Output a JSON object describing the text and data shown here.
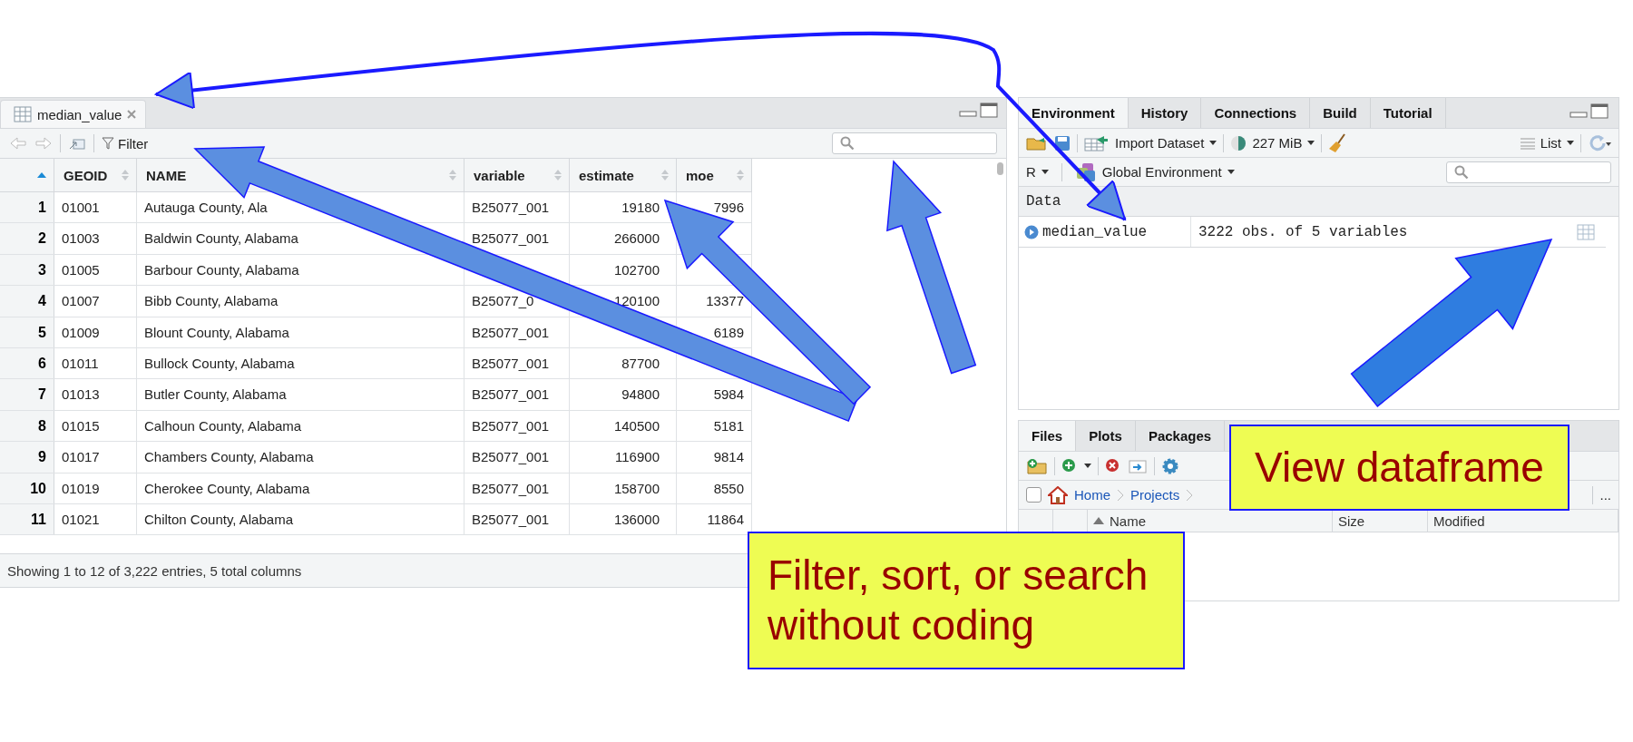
{
  "viewer_pane": {
    "tab": {
      "title": "median_value",
      "selected": true
    },
    "filter_label": "Filter",
    "columns": [
      {
        "label": "GEOID"
      },
      {
        "label": "NAME"
      },
      {
        "label": "variable"
      },
      {
        "label": "estimate"
      },
      {
        "label": "moe"
      }
    ],
    "rows": [
      {
        "index": "1",
        "cells": [
          "01001",
          "Autauga County, Ala",
          "B25077_001",
          "19180",
          "7996"
        ]
      },
      {
        "index": "2",
        "cells": [
          "01003",
          "Baldwin County, Alabama",
          "B25077_001",
          "266000",
          null
        ]
      },
      {
        "index": "3",
        "cells": [
          "01005",
          "Barbour County, Alabama",
          null,
          "102700",
          null
        ]
      },
      {
        "index": "4",
        "cells": [
          "01007",
          "Bibb County, Alabama",
          "B25077_0",
          "120100",
          "13377"
        ]
      },
      {
        "index": "5",
        "cells": [
          "01009",
          "Blount County, Alabama",
          "B25077_001",
          null,
          "6189"
        ]
      },
      {
        "index": "6",
        "cells": [
          "01011",
          "Bullock County, Alabama",
          "B25077_001",
          "87700",
          null
        ]
      },
      {
        "index": "7",
        "cells": [
          "01013",
          "Butler County, Alabama",
          "B25077_001",
          "94800",
          "5984"
        ]
      },
      {
        "index": "8",
        "cells": [
          "01015",
          "Calhoun County, Alabama",
          "B25077_001",
          "140500",
          "5181"
        ]
      },
      {
        "index": "9",
        "cells": [
          "01017",
          "Chambers County, Alabama",
          "B25077_001",
          "116900",
          "9814"
        ]
      },
      {
        "index": "10",
        "cells": [
          "01019",
          "Cherokee County, Alabama",
          "B25077_001",
          "158700",
          "8550"
        ]
      },
      {
        "index": "11",
        "cells": [
          "01021",
          "Chilton County, Alabama",
          "B25077_001",
          "136000",
          "11864"
        ]
      }
    ],
    "footer": "Showing 1 to 12 of 3,222 entries, 5 total columns"
  },
  "environment_pane": {
    "tabs": [
      {
        "label": "Environment",
        "selected": true
      },
      {
        "label": "History",
        "selected": false
      },
      {
        "label": "Connections",
        "selected": false
      },
      {
        "label": "Build",
        "selected": false
      },
      {
        "label": "Tutorial",
        "selected": false
      }
    ],
    "import_label": "Import Dataset",
    "memory": "227 MiB",
    "view_mode": "List",
    "language": "R",
    "scope": "Global Environment",
    "section": "Data",
    "objects": [
      {
        "name": "median_value",
        "summary": "3222 obs. of 5 variables"
      }
    ]
  },
  "files_pane": {
    "tabs": [
      {
        "label": "Files",
        "selected": true
      },
      {
        "label": "Plots",
        "selected": false
      },
      {
        "label": "Packages",
        "selected": false
      }
    ],
    "select_all_checked": false,
    "breadcrumbs": [
      "Home",
      "Projects"
    ],
    "more": "...",
    "columns": [
      "Name",
      "Size",
      "Modified"
    ]
  },
  "callouts": [
    {
      "text": "View dataframe"
    },
    {
      "text": "Filter, sort, or search without coding"
    }
  ]
}
